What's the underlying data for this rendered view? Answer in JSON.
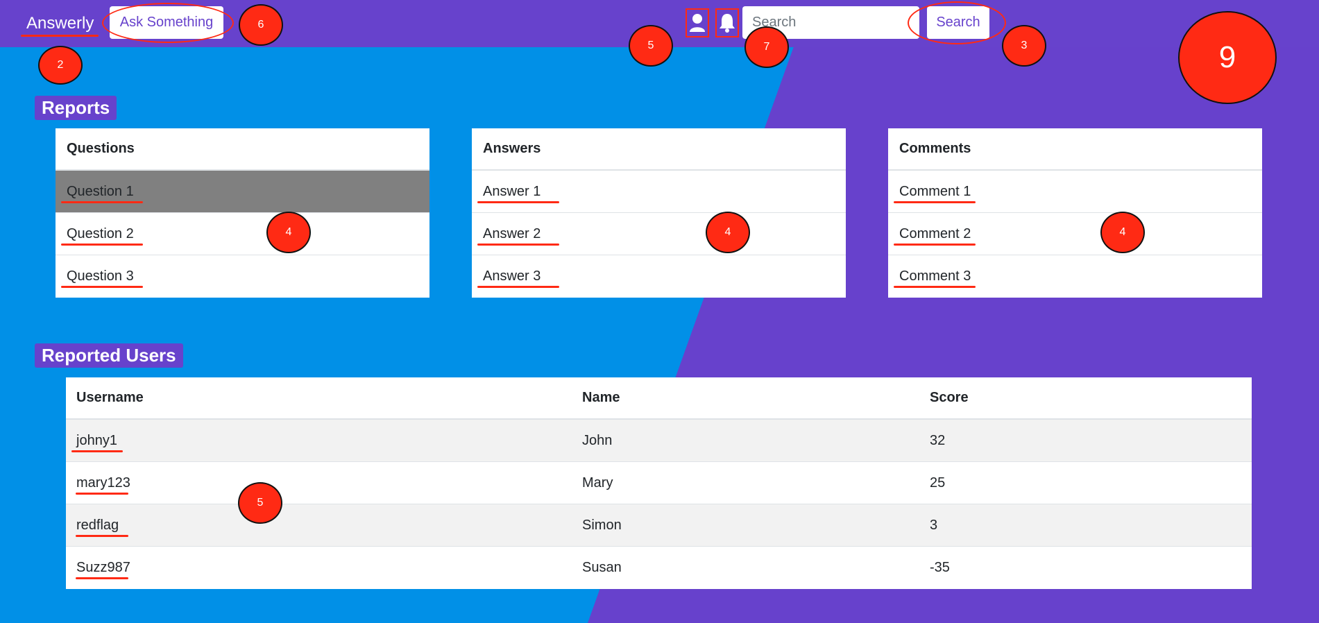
{
  "header": {
    "brand": "Answerly",
    "ask_button": "Ask Something",
    "search_placeholder": "Search",
    "search_button": "Search"
  },
  "reports": {
    "title": "Reports",
    "questions": {
      "header": "Questions",
      "items": [
        "Question 1",
        "Question 2",
        "Question 3"
      ]
    },
    "answers": {
      "header": "Answers",
      "items": [
        "Answer 1",
        "Answer 2",
        "Answer 3"
      ]
    },
    "comments": {
      "header": "Comments",
      "items": [
        "Comment 1",
        "Comment 2",
        "Comment 3"
      ]
    }
  },
  "reported_users": {
    "title": "Reported Users",
    "columns": [
      "Username",
      "Name",
      "Score"
    ],
    "rows": [
      {
        "username": "johny1",
        "name": "John",
        "score": "32"
      },
      {
        "username": "mary123",
        "name": "Mary",
        "score": "25"
      },
      {
        "username": "redflag",
        "name": "Simon",
        "score": "3"
      },
      {
        "username": "Suzz987",
        "name": "Susan",
        "score": "-35"
      }
    ]
  },
  "annotations": {
    "badge_brand": "2",
    "badge_ask": "6",
    "badge_user_icon": "5",
    "badge_bell": "7",
    "badge_search": "3",
    "badge_corner": "9",
    "badge_questions": "4",
    "badge_answers": "4",
    "badge_comments": "4",
    "badge_users": "5"
  },
  "colors": {
    "purple": "#6742cc",
    "blue": "#0190e7",
    "annotation_red": "#ff2a14"
  },
  "icons": [
    "user-icon",
    "bell-icon"
  ]
}
